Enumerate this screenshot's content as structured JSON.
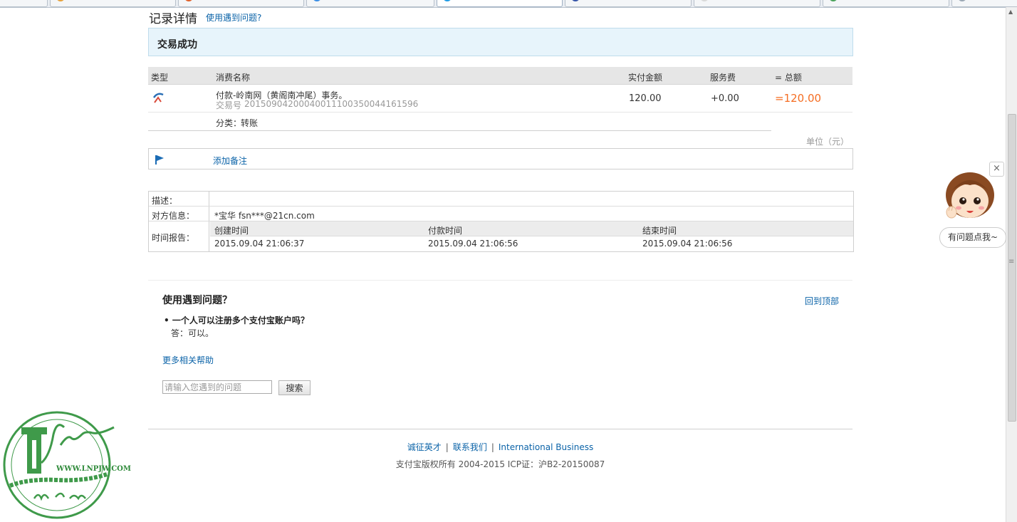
{
  "page": {
    "title": "记录详情",
    "help_link": "使用遇到问题?",
    "status": "交易成功"
  },
  "table": {
    "headers": [
      "类型",
      "消费名称",
      "实付金额",
      "服务费",
      "= 总额"
    ],
    "row": {
      "name": "付款-岭南网（黄阁南冲尾）事务。",
      "tx_no_label": "交易号",
      "tx_no": "2015090420004001110035004416159​6",
      "amount": "120.00",
      "fee": "+0.00",
      "total": "=120.00"
    },
    "category_label": "分类：",
    "category_value": "转账",
    "unit": "单位（元）"
  },
  "note": {
    "add_label": "添加备注"
  },
  "info": {
    "desc_label": "描述：",
    "desc_value": "",
    "party_label": "对方信息：",
    "party_value": "*宝华 fsn***@21cn.com",
    "time_label": "时间报告：",
    "time_headers": [
      "创建时间",
      "付款时间",
      "结束时间"
    ],
    "time_values": [
      "2015.09.04 21:06:37",
      "2015.09.04 21:06:56",
      "2015.09.04 21:06:56"
    ]
  },
  "help": {
    "title": "使用遇到问题？",
    "back_top": "回到顶部",
    "question": "一个人可以注册多个支付宝账户吗？",
    "answer": "答：可以。",
    "more_help": "更多相关帮助",
    "search_placeholder": "请输入您遇到的问题",
    "search_button": "搜索"
  },
  "footer": {
    "links": [
      "诚征英才",
      "联系我们",
      "International Business"
    ],
    "separator": "|",
    "copyright": "支付宝版权所有 2004-2015 ICP证：沪B2-20150087"
  },
  "chat": {
    "bubble": "有问题点我~",
    "close": "×"
  },
  "watermark": {
    "url": "WWW.LNPJW.COM"
  },
  "colors": {
    "link": "#0b63a8",
    "total": "#f56d22",
    "status_bg": "#e7f4fb",
    "watermark": "#2f8a3a"
  },
  "icons": [
    "transfer-icon",
    "flag-icon",
    "close-icon",
    "avatar-icon",
    "scroll-up-icon"
  ]
}
